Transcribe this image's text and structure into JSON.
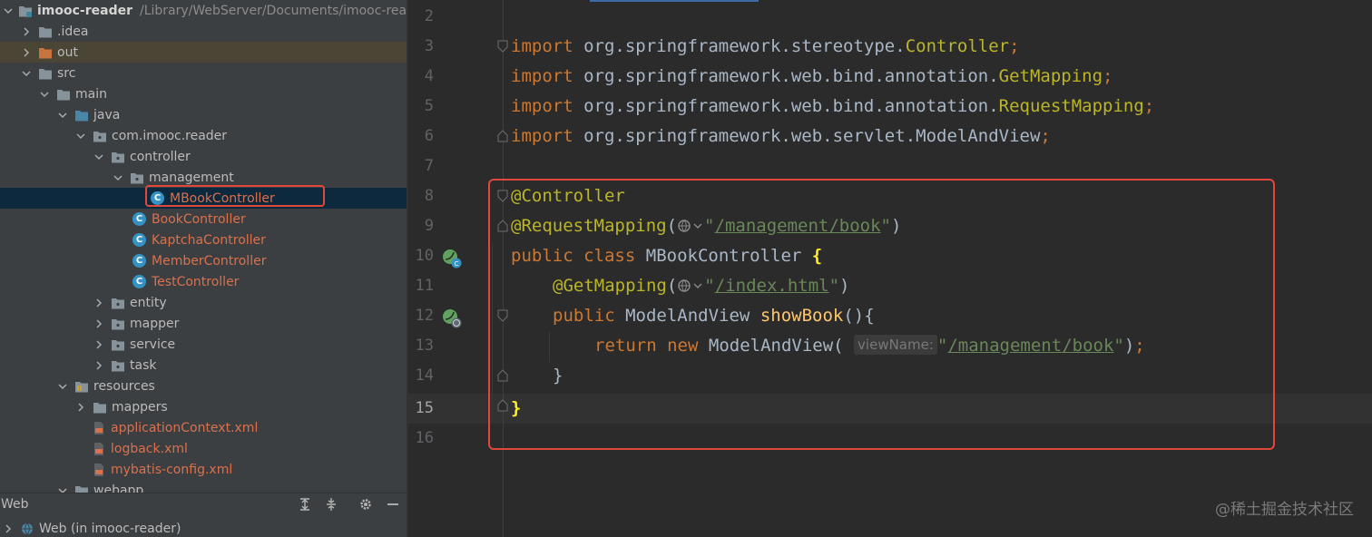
{
  "project_tree": {
    "root": {
      "name": "imooc-reader",
      "path": "/Library/WebServer/Documents/imooc-rea"
    },
    "items": {
      "idea": ".idea",
      "out": "out",
      "src": "src",
      "main": "main",
      "java": "java",
      "package": "com.imooc.reader",
      "controller": "controller",
      "management": "management",
      "mbook": "MBookController",
      "book": "BookController",
      "kaptcha": "KaptchaController",
      "member": "MemberController",
      "test": "TestController",
      "entity": "entity",
      "mapper": "mapper",
      "service": "service",
      "task": "task",
      "resources": "resources",
      "mappers": "mappers",
      "app_ctx": "applicationContext.xml",
      "logback": "logback.xml",
      "mybatis": "mybatis-config.xml",
      "webapp": "webapp"
    }
  },
  "web_panel": {
    "title": "Web",
    "item": "Web (in imooc-reader)"
  },
  "editor": {
    "line_numbers": [
      "2",
      "3",
      "4",
      "5",
      "6",
      "7",
      "8",
      "9",
      "10",
      "11",
      "12",
      "13",
      "14",
      "15",
      "16"
    ],
    "current_line": "15",
    "imports": [
      {
        "kw": "import",
        "pkg": " org.springframework.stereotype.",
        "cls": "Controller",
        "end": ";"
      },
      {
        "kw": "import",
        "pkg": " org.springframework.web.bind.annotation.",
        "cls": "GetMapping",
        "end": ";"
      },
      {
        "kw": "import",
        "pkg": " org.springframework.web.bind.annotation.",
        "cls": "RequestMapping",
        "end": ";"
      },
      {
        "kw": "import",
        "pkg": " org.springframework.web.servlet.ModelAndView",
        "cls": "",
        "end": ";"
      }
    ],
    "code": {
      "ann_controller": "@Controller",
      "ann_request": "@RequestMapping",
      "path_book": "/management/book",
      "kw_public": "public",
      "kw_class": "class",
      "class_name": "MBookController",
      "ann_get": "@GetMapping",
      "path_index": "/index.html",
      "type_mav": "ModelAndView",
      "method": "showBook",
      "kw_return": "return",
      "kw_new": "new",
      "hint_view": "viewName:",
      "path_return": "/management/book"
    }
  },
  "watermark": "@稀土掘金技术社区",
  "colors": {
    "highlight_box": "#e0483c",
    "selected_row": "#0d293e",
    "keyword": "#cc7832",
    "annotation": "#bbb529",
    "string": "#6a8759"
  }
}
